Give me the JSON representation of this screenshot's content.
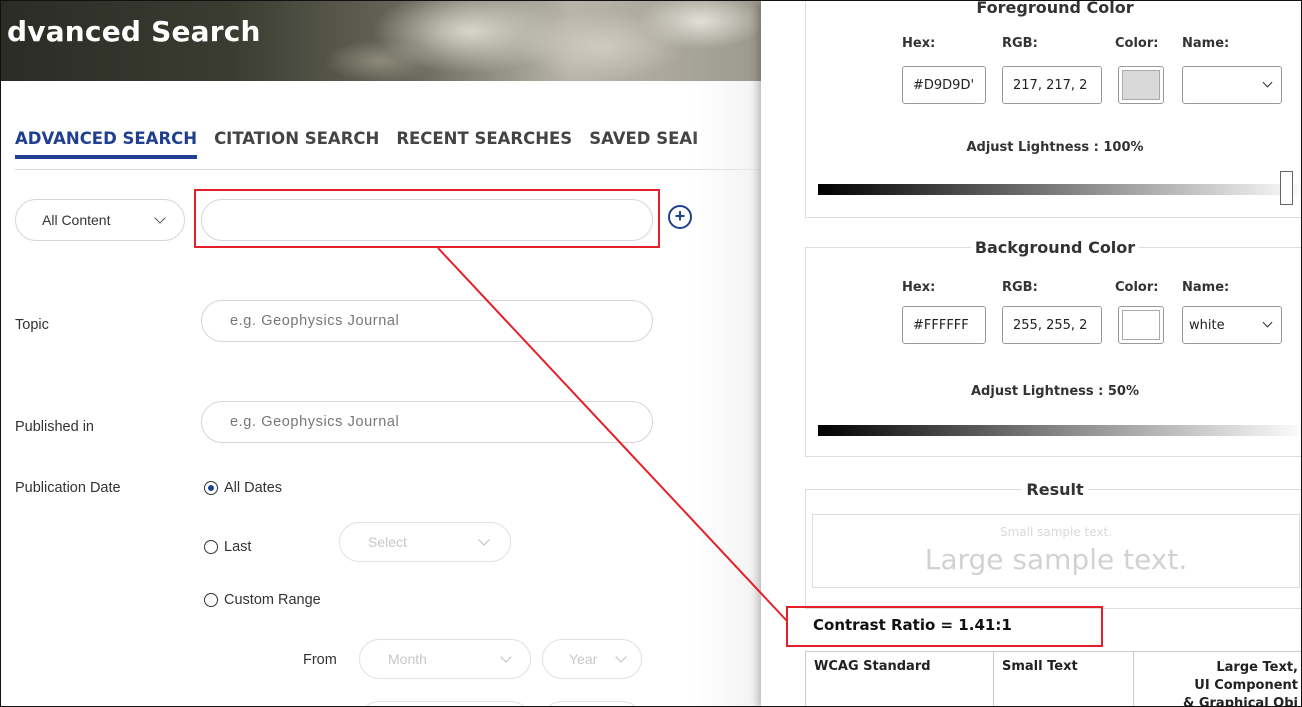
{
  "header": {
    "title": "dvanced Search"
  },
  "tabs": [
    "ADVANCED SEARCH",
    "CITATION SEARCH",
    "RECENT SEARCHES",
    "SAVED SEAI"
  ],
  "search": {
    "content_type": "All Content",
    "main_value": ""
  },
  "fields": {
    "topic_label": "Topic",
    "topic_placeholder": "e.g. Geophysics Journal",
    "published_label": "Published in",
    "published_placeholder": "e.g. Geophysics Journal",
    "pubdate_label": "Publication Date",
    "all_dates": "All Dates",
    "last": "Last",
    "last_select": "Select",
    "custom_range": "Custom Range",
    "from_label": "From",
    "month": "Month",
    "year": "Year"
  },
  "panel": {
    "fg": {
      "title": "Foreground Color",
      "hex_label": "Hex:",
      "rgb_label": "RGB:",
      "color_label": "Color:",
      "name_label": "Name:",
      "hex": "#D9D9D'",
      "rgb": "217, 217, 2",
      "name": "",
      "swatch": "#D9D9D9",
      "lightness_label": "Adjust Lightness : 100%",
      "lightness_percent": 100
    },
    "bg": {
      "title": "Background Color",
      "hex_label": "Hex:",
      "rgb_label": "RGB:",
      "color_label": "Color:",
      "name_label": "Name:",
      "hex": "#FFFFFF",
      "rgb": "255, 255, 2",
      "name": "white",
      "swatch": "#FFFFFF",
      "lightness_label": "Adjust Lightness : 50%",
      "lightness_percent": 50
    },
    "result": {
      "title": "Result",
      "small_sample": "Small sample text.",
      "large_sample": "Large sample text."
    },
    "contrast": "Contrast Ratio = 1.41:1",
    "table": {
      "col1": "WCAG Standard",
      "col2": "Small Text",
      "col3_line1": "Large Text,",
      "col3_line2": "UI Component",
      "col3_line3": "& Graphical Obj"
    }
  },
  "colors": {
    "accent": "#1f3f8f",
    "highlight": "#e5202a"
  }
}
